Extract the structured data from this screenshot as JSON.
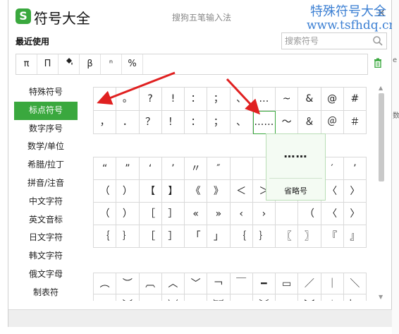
{
  "window": {
    "title": "符号大全",
    "ime_name": "搜狗五笔输入法",
    "close_glyph": "×",
    "logo_letter": "S"
  },
  "watermark": {
    "line1": "特殊符号大全",
    "line2": "www.tsfhdq.cn"
  },
  "recent": {
    "title": "最近使用",
    "symbols": [
      "π",
      "Π",
      "",
      "β",
      "ⁿ",
      "%"
    ]
  },
  "search": {
    "placeholder": "搜索符号"
  },
  "sidebar": {
    "items": [
      "特殊符号",
      "标点符号",
      "数字序号",
      "数学/单位",
      "希腊/拉丁",
      "拼音/注音",
      "中文字符",
      "英文音标",
      "日文字符",
      "韩文字符",
      "俄文字母",
      "制表符"
    ],
    "active_index": 1
  },
  "grid1": [
    ",",
    "。",
    "?",
    "!",
    "：",
    "；",
    "、",
    "…",
    "~",
    "&",
    "@",
    "#",
    "，",
    "．",
    "？",
    "！",
    "：",
    "；",
    "、",
    "……",
    "～",
    "＆",
    "＠",
    "＃"
  ],
  "grid2": [
    "“",
    "”",
    "‘",
    "’",
    "〃",
    "″",
    "",
    "",
    "",
    "",
    "′",
    "’",
    "（",
    "）",
    "【",
    "】",
    "《",
    "》",
    "＜",
    "＞",
    "",
    "",
    "〈",
    "〉",
    "（",
    "）",
    "［",
    "］",
    "«",
    "»",
    "‹",
    "›",
    "",
    "（",
    "〈",
    "〉",
    "｛",
    "｝",
    "［",
    "］",
    "「",
    "」",
    "｛",
    "｝",
    "〖",
    "〗",
    "『",
    "』"
  ],
  "grid3": [
    "︵",
    "︶",
    "︹",
    "︿",
    "﹀",
    "￢",
    "￣",
    "━",
    "▭",
    "／",
    "｜",
    "＼",
    "︵",
    "︶",
    "︹",
    "︺",
    "︷",
    "︸",
    "︽",
    "︾",
    "︻",
    "︼",
    "︱",
    "﹂"
  ],
  "tooltip": {
    "symbol": "……",
    "name": "省略号"
  },
  "right_strip": {
    "ch1": "e",
    "ch2": "数"
  },
  "colors": {
    "accent": "#3aa83e",
    "watermark": "#3b7fd3",
    "arrow": "#e02020"
  }
}
